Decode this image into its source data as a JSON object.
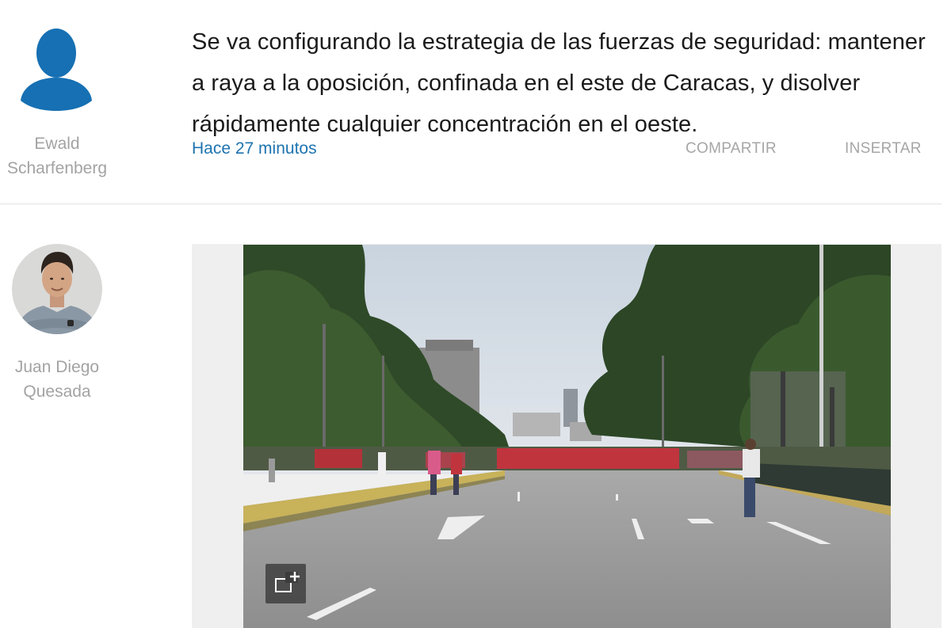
{
  "entries": [
    {
      "author": {
        "name_line1": "Ewald",
        "name_line2": "Scharfenberg",
        "avatar": "person-silhouette-icon"
      },
      "text": "Se va configurando la estrategia de las fuerzas de seguridad: mantener a raya a la oposición, confinada en el este de Caracas, y disolver rápidamente cualquier concentración en el oeste.",
      "time": "Hace 27 minutos",
      "actions": {
        "share": "COMPARTIR",
        "embed": "INSERTAR"
      }
    },
    {
      "author": {
        "name_line1": "Juan Diego",
        "name_line2": "Quesada",
        "avatar": "author-photo"
      },
      "media": {
        "type": "photo",
        "expand_icon": "expand-add-icon"
      }
    }
  ],
  "colors": {
    "text": "#1b1b1b",
    "muted": "#a3a3a3",
    "link": "#1d73b0",
    "avatar_blue": "#1670b3",
    "divider": "#e2e2e2",
    "media_background": "#efefef"
  }
}
